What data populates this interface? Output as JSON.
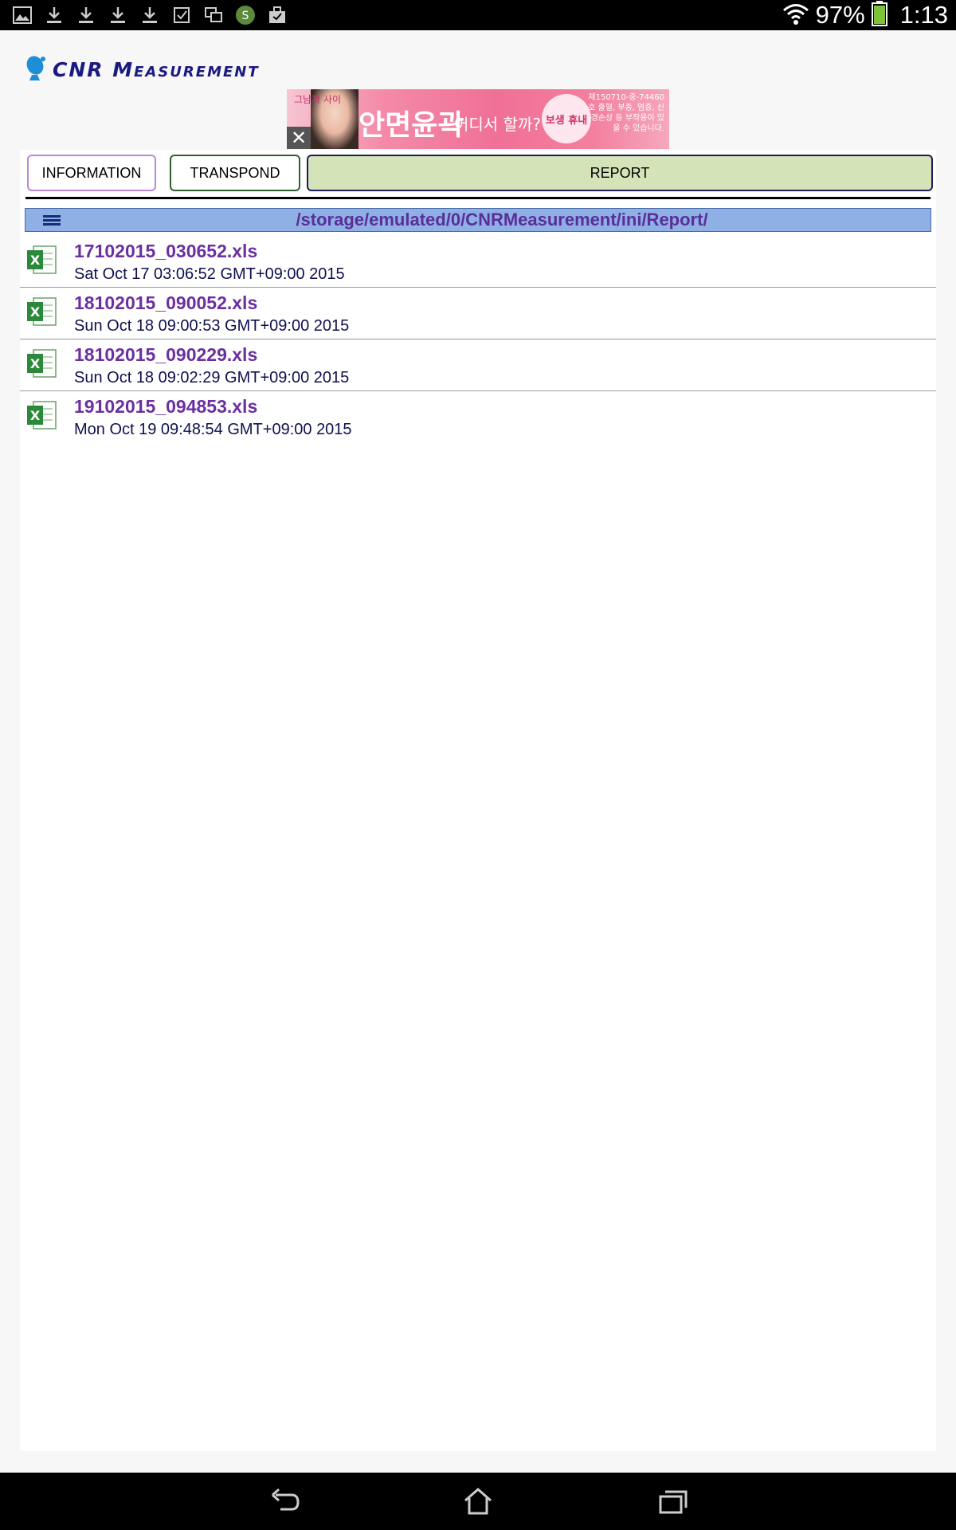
{
  "status_bar": {
    "battery": "97%",
    "time": "1:13",
    "notification_icons": [
      "image-icon",
      "download-icon",
      "download-icon",
      "download-icon",
      "download-icon",
      "checkbox-icon",
      "screens-icon",
      "coin-icon",
      "briefcase-icon"
    ]
  },
  "header": {
    "logo_text": "CNR Measurement"
  },
  "ad": {
    "small_text": "그남자 사이",
    "main_text": "안면윤곽",
    "sub_text": "어디서 할까?",
    "badge_text": "보생\n휴내",
    "fine_text": "제150710-중-74460호 출혈, 부종, 염증, 신경손상 등 부작용이 있을 수 있습니다.",
    "close_label": "✕"
  },
  "tabs": {
    "information": "INFORMATION",
    "transpond": "TRANSPOND",
    "report": "REPORT"
  },
  "path": "/storage/emulated/0/CNRMeasurement/ini/Report/",
  "files": [
    {
      "name": "17102015_030652.xls",
      "date": "Sat Oct 17 03:06:52 GMT+09:00 2015"
    },
    {
      "name": "18102015_090052.xls",
      "date": "Sun Oct 18 09:00:53 GMT+09:00 2015"
    },
    {
      "name": "18102015_090229.xls",
      "date": "Sun Oct 18 09:02:29 GMT+09:00 2015"
    },
    {
      "name": "19102015_094853.xls",
      "date": "Mon Oct 19 09:48:54 GMT+09:00 2015"
    }
  ],
  "colors": {
    "accent_tab": "#d5e4b8",
    "path_bar": "#8eb0e4",
    "file_name": "#6b2fa0"
  }
}
